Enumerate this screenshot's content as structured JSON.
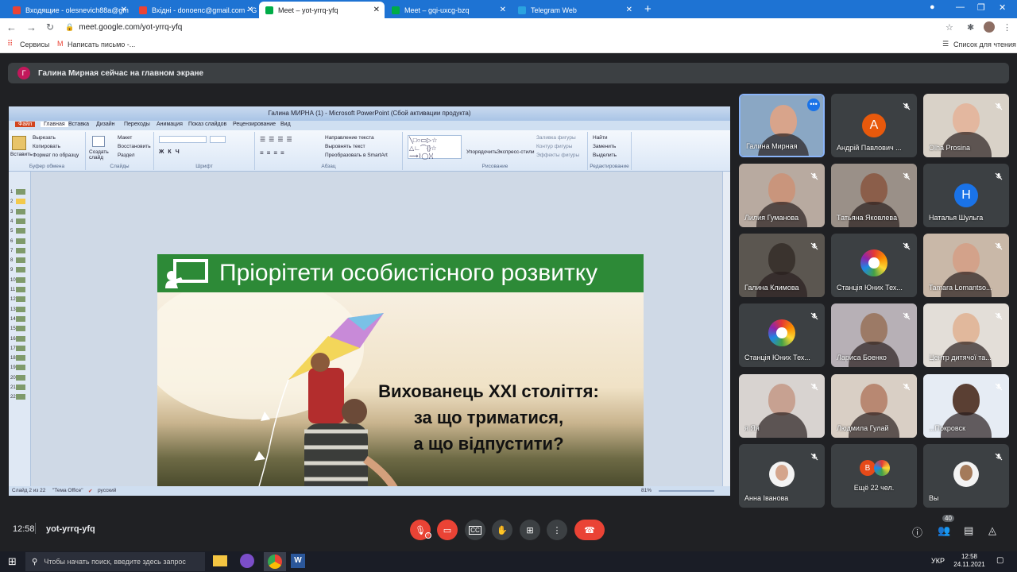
{
  "browser": {
    "tabs": [
      {
        "title": "Входящие - olesnevich88a@gm",
        "icon_color": "#ea4335",
        "active": false
      },
      {
        "title": "Вхідні - donoenc@gmail.com - G",
        "icon_color": "#ea4335",
        "active": false
      },
      {
        "title": "Meet – yot-yrrq-yfq",
        "icon_color": "#00ac47",
        "active": true
      },
      {
        "title": "Meet – gqi-uxcg-bzq",
        "icon_color": "#00ac47",
        "active": false
      },
      {
        "title": "Telegram Web",
        "icon_color": "#2aa3e0",
        "active": false
      }
    ],
    "url": "meet.google.com/yot-yrrq-yfq",
    "bookmarks": {
      "apps": "Сервисы",
      "compose": "Написать письмо -...",
      "reading_list": "Список для чтения"
    }
  },
  "banner": {
    "avatar_letter": "Г",
    "text": "Галина Мирная сейчас на главном экране"
  },
  "powerpoint": {
    "window_title": "Галина МИРНА (1) - Microsoft PowerPoint (Сбой активации продукта)",
    "tabs": [
      "Файл",
      "Главная",
      "Вставка",
      "Дизайн",
      "Переходы",
      "Анимация",
      "Показ слайдов",
      "Рецензирование",
      "Вид"
    ],
    "groups": [
      "Буфер обмена",
      "Слайды",
      "Шрифт",
      "Абзац",
      "Рисование",
      "Редактирование"
    ],
    "buttons": {
      "paste": "Вставить",
      "cut": "Вырезать",
      "copy": "Копировать",
      "format": "Формат по образцу",
      "new_slide": "Создать слайд",
      "layout": "Макет",
      "reset": "Восстановить",
      "section": "Раздел",
      "text_dir": "Направление текста",
      "align_text": "Выровнять текст",
      "smartart": "Преобразовать в SmartArt",
      "arrange": "Упорядочить",
      "quick_styles": "Экспресс-стили",
      "fill": "Заливка фигуры",
      "outline": "Контур фигуры",
      "effects": "Эффекты фигуры",
      "find": "Найти",
      "replace": "Заменить",
      "select": "Выделить"
    },
    "thumb_count": 22,
    "status": {
      "slide": "Слайд 2 из 22",
      "theme": "\"Тема Office\"",
      "lang": "русский",
      "zoom": "81%"
    }
  },
  "slide": {
    "title": "Пріорітети особистісного розвитку",
    "line1": "Вихованець XXI століття:",
    "line2": "за що триматися,",
    "line3": "а що відпустити?"
  },
  "participants": [
    {
      "name": "Галина Мирная",
      "kind": "photo",
      "bg": "#8aa7c4",
      "face": "#d8a48b",
      "pinned": true
    },
    {
      "name": "Андрій Павлович ...",
      "kind": "letter",
      "letter": "А",
      "color": "#e8590c",
      "muted": true
    },
    {
      "name": "Olha Prosina",
      "kind": "photo",
      "bg": "#d9d2c8",
      "face": "#e3b79f",
      "muted": true
    },
    {
      "name": "Лилия Гуманова",
      "kind": "photo",
      "bg": "#b8aaa0",
      "face": "#c9957c",
      "muted": true
    },
    {
      "name": "Татьяна Яковлева",
      "kind": "photo",
      "bg": "#9a9088",
      "face": "#8b5e4a",
      "muted": true
    },
    {
      "name": "Наталья Шульга",
      "kind": "letter",
      "letter": "Н",
      "color": "#1a73e8",
      "muted": true
    },
    {
      "name": "Галина Климова",
      "kind": "photo",
      "bg": "#5b5650",
      "face": "#3a332e",
      "muted": true
    },
    {
      "name": "Станція Юних Тех...",
      "kind": "logo",
      "muted": true
    },
    {
      "name": "Tamara Lomantso...",
      "kind": "photo",
      "bg": "#c9b8a8",
      "face": "#d3a28a",
      "muted": true
    },
    {
      "name": "Станція Юних Тех...",
      "kind": "logo",
      "muted": true
    },
    {
      "name": "Лариса Боенко",
      "kind": "photo",
      "bg": "#b7b0b6",
      "face": "#9c7a66",
      "muted": true
    },
    {
      "name": "Центр дитячої та...",
      "kind": "photo",
      "bg": "#e3ded8",
      "face": "#e1b89c",
      "muted": true
    },
    {
      "name": "я Яя",
      "kind": "photo",
      "bg": "#d8d3d0",
      "face": "#c7a191",
      "muted": true
    },
    {
      "name": "Людмила Гулай",
      "kind": "photo",
      "bg": "#d9cfc5",
      "face": "#b88872",
      "muted": true
    },
    {
      "name": "...Покровск",
      "kind": "photo",
      "bg": "#e6ecf4",
      "face": "#5a3f33",
      "muted": true
    },
    {
      "name": "Анна Іванова",
      "kind": "avatar",
      "bg": "#f3f3f3",
      "face": "#d4a58c",
      "muted": true
    },
    {
      "name": "Ещё 22 чел.",
      "kind": "more",
      "letter": "В",
      "color": "#e64a19"
    },
    {
      "name": "Вы",
      "kind": "avatar",
      "bg": "#f3f3f3",
      "face": "#a47a5a",
      "muted": true
    }
  ],
  "bottom": {
    "time": "12:58",
    "meeting_code": "yot-yrrq-yfq",
    "people_count": "40"
  },
  "taskbar": {
    "search_placeholder": "Чтобы начать поиск, введите здесь запрос",
    "lang": "УКР",
    "time": "12:58",
    "date": "24.11.2021"
  }
}
